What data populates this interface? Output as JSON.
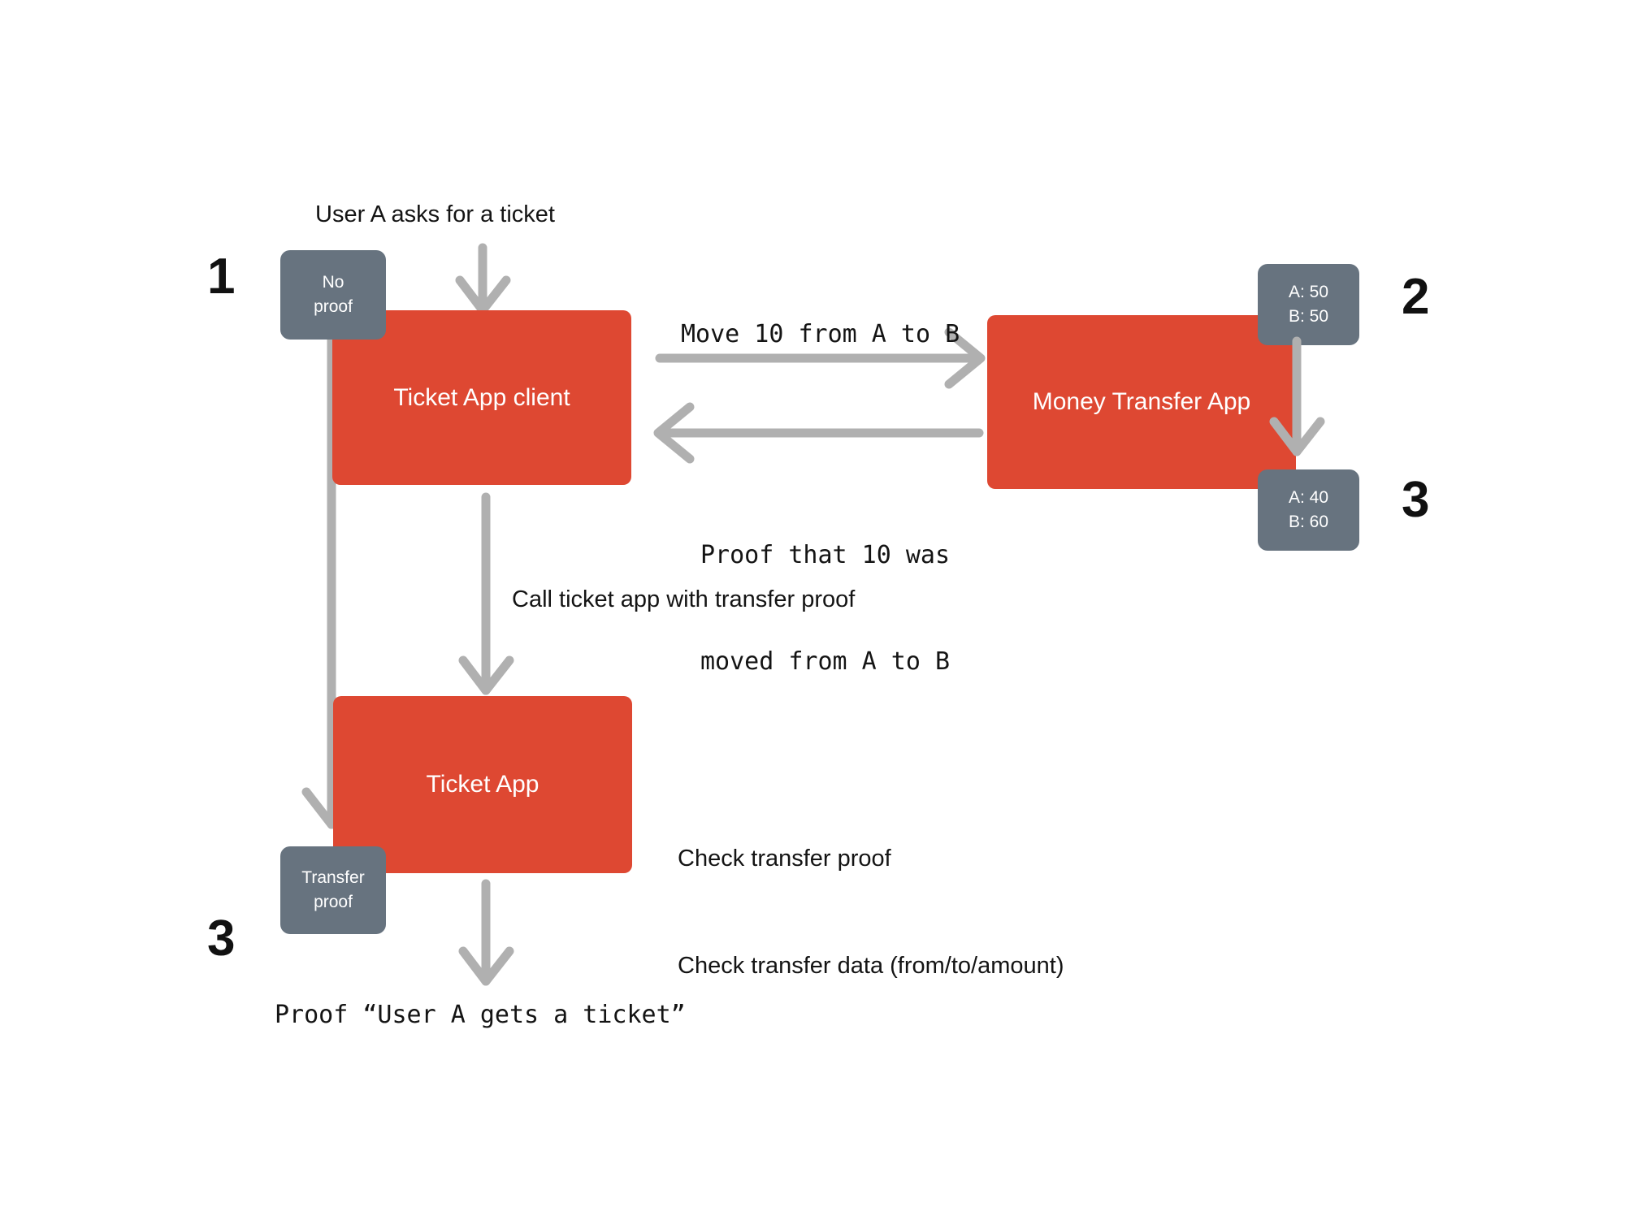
{
  "diagram": {
    "title_colors": {
      "process_box": "#de4832",
      "badge": "#67737f",
      "arrow": "#b0b0b0",
      "text": "#141414",
      "background": "#ffffff"
    },
    "boxes": [
      {
        "id": "ticket-app-client",
        "label": "Ticket App client"
      },
      {
        "id": "money-transfer-app",
        "label": "Money Transfer App"
      },
      {
        "id": "ticket-app",
        "label": "Ticket App"
      }
    ],
    "badges": [
      {
        "id": "no-proof",
        "lines": [
          "No",
          "proof"
        ]
      },
      {
        "id": "balance-before",
        "lines": [
          "A: 50",
          "B: 50"
        ]
      },
      {
        "id": "balance-after",
        "lines": [
          "A: 40",
          "B: 60"
        ]
      },
      {
        "id": "transfer-proof",
        "lines": [
          "Transfer",
          "proof"
        ]
      }
    ],
    "step_numbers": [
      {
        "id": "step-1",
        "value": "1"
      },
      {
        "id": "step-2",
        "value": "2"
      },
      {
        "id": "step-3-right",
        "value": "3"
      },
      {
        "id": "step-3-left",
        "value": "3"
      }
    ],
    "labels": {
      "user_asks": "User A asks for a ticket",
      "move_request": "Move 10 from A to B",
      "proof_moved_line1": "Proof that 10 was",
      "proof_moved_line2": "moved from A to B",
      "call_ticket_app": "Call ticket app with transfer proof",
      "check_line1": "Check transfer proof",
      "check_line2": "Check transfer data (from/to/amount)",
      "final_proof": "Proof “User A gets a ticket”"
    }
  }
}
